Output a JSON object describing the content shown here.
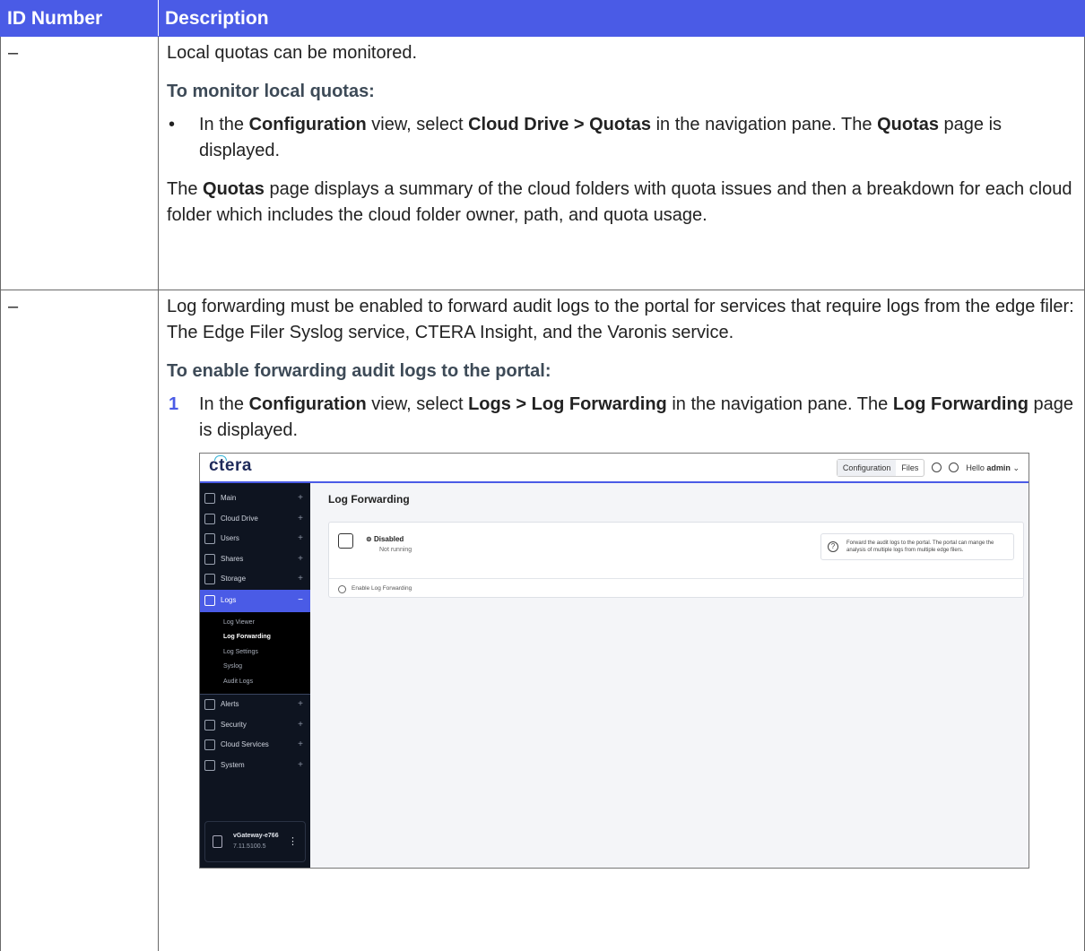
{
  "table": {
    "headers": [
      "ID Number",
      "Description"
    ],
    "rows": [
      {
        "id": "–",
        "p1": "Local quotas can be monitored.",
        "heading": "To monitor local quotas:",
        "bullet_marker": "•",
        "bullet": {
          "t1": "In the ",
          "b1": "Configuration",
          "t2": " view, select ",
          "b2": "Cloud Drive > Quotas",
          "t3": " in the navigation pane. The ",
          "b3": "Quotas",
          "t4": " page is displayed."
        },
        "p2": {
          "t1": "The ",
          "b1": "Quotas",
          "t2": " page displays a summary of the cloud folders with quota issues and then a breakdown for each cloud folder which includes the cloud folder owner, path, and quota usage."
        }
      },
      {
        "id": "–",
        "p1": "Log forwarding must be enabled to forward audit logs to the portal for services that require logs from the edge filer: The Edge Filer Syslog service, CTERA Insight, and the Varonis service.",
        "heading": "To enable forwarding audit logs to the portal:",
        "step_number": "1",
        "step": {
          "t1": "In the ",
          "b1": "Configuration",
          "t2": " view, select ",
          "b2": "Logs > Log Forwarding",
          "t3": " in the navigation pane. The ",
          "b3": "Log Forwarding",
          "t4": " page is displayed."
        }
      }
    ]
  },
  "screenshot": {
    "logo": "ctera",
    "tabs": [
      "Configuration",
      "Files"
    ],
    "greeting": "Hello",
    "user": "admin",
    "nav_top": [
      {
        "label": "Main",
        "icon": "grid-icon"
      },
      {
        "label": "Cloud Drive",
        "icon": "cloud-drive-icon"
      },
      {
        "label": "Users",
        "icon": "users-icon"
      },
      {
        "label": "Shares",
        "icon": "share-icon"
      },
      {
        "label": "Storage",
        "icon": "storage-icon"
      }
    ],
    "nav_active": {
      "label": "Logs",
      "icon": "logs-icon"
    },
    "nav_sub": [
      "Log Viewer",
      "Log Forwarding",
      "Log Settings",
      "Syslog",
      "Audit Logs"
    ],
    "nav_bottom": [
      {
        "label": "Alerts",
        "icon": "bell-icon"
      },
      {
        "label": "Security",
        "icon": "shield-icon"
      },
      {
        "label": "Cloud Services",
        "icon": "cloud-icon"
      },
      {
        "label": "System",
        "icon": "system-icon"
      }
    ],
    "nav_plus": "+",
    "nav_minus": "−",
    "device": {
      "name": "vGateway-e766",
      "version": "7.11.5100.5"
    },
    "page_title": "Log Forwarding",
    "status_title": "Disabled",
    "status_sub": "Not running",
    "info_text": "Forward the audit logs to the portal. The portal can mange the analysis of multiple logs from multiple edge filers.",
    "enable_label": "Enable Log Forwarding",
    "accent": "#4a5be6"
  }
}
